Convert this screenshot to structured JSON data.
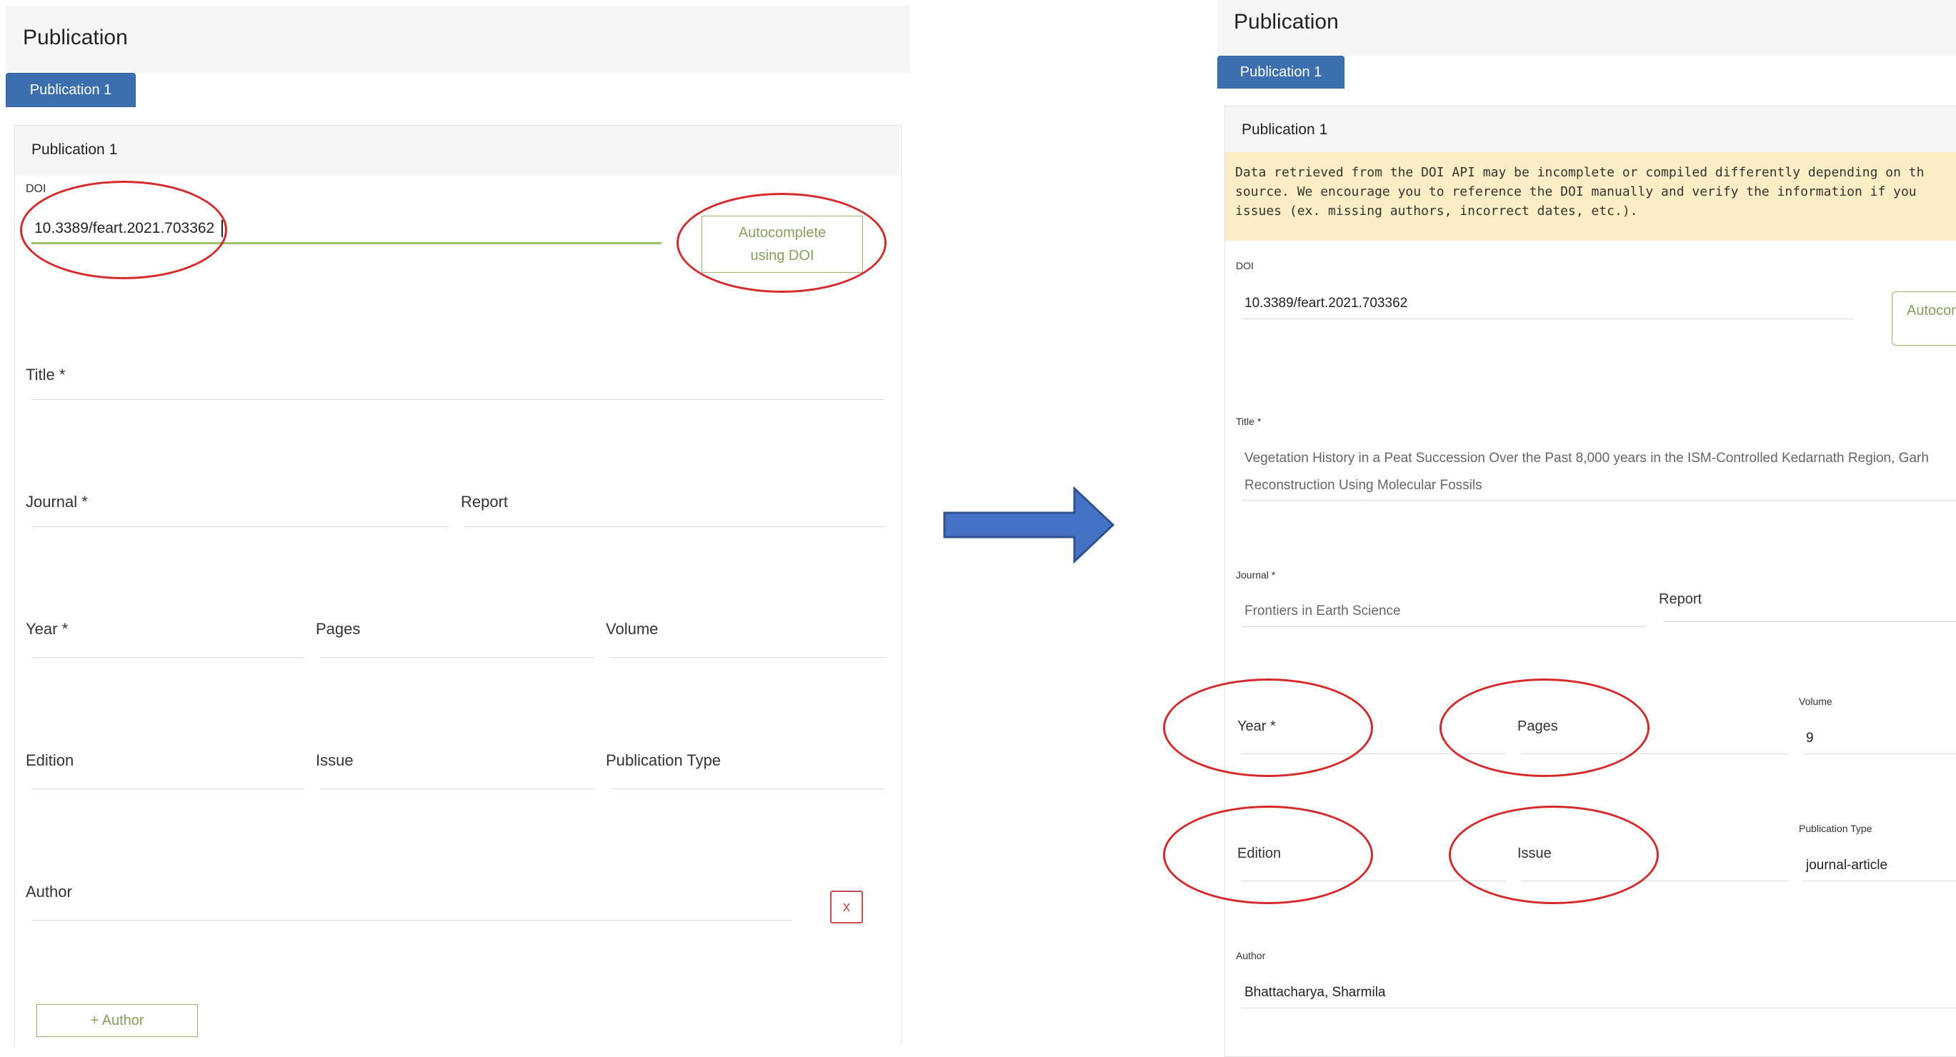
{
  "left": {
    "title": "Publication",
    "tab_label": "Publication 1",
    "card_title": "Publication 1",
    "doi_label": "DOI",
    "doi_value": "10.3389/feart.2021.703362",
    "autocomplete_label": "Autocomplete using DOI",
    "title_label": "Title *",
    "journal_label": "Journal *",
    "report_label": "Report",
    "year_label": "Year *",
    "pages_label": "Pages",
    "volume_label": "Volume",
    "edition_label": "Edition",
    "issue_label": "Issue",
    "publication_type_label": "Publication Type",
    "author_label": "Author",
    "remove_author_label": "x",
    "add_author_label": "+ Author"
  },
  "right": {
    "title": "Publication",
    "tab_label": "Publication 1",
    "card_title": "Publication 1",
    "warning_line1": "Data retrieved from the DOI API may be incomplete or compiled differently depending on th",
    "warning_line2": "source. We encourage you to reference the DOI manually and verify the information if you",
    "warning_line3": "issues (ex. missing authors, incorrect dates, etc.).",
    "doi_label": "DOI",
    "doi_value": "10.3389/feart.2021.703362",
    "autocomplete_label": "Autocom",
    "title_label": "Title *",
    "title_line1": "Vegetation History in a Peat Succession Over the Past 8,000 years in the ISM-Controlled Kedarnath Region, Garh",
    "title_line2": "Reconstruction Using Molecular Fossils",
    "journal_label": "Journal *",
    "journal_value": "Frontiers in Earth Science",
    "report_label": "Report",
    "year_label": "Year *",
    "pages_label": "Pages",
    "volume_label": "Volume",
    "volume_value": "9",
    "edition_label": "Edition",
    "issue_label": "Issue",
    "publication_type_label": "Publication Type",
    "publication_type_value": "journal-article",
    "author_label": "Author",
    "author_value": "Bhattacharya, Sharmila"
  },
  "colors": {
    "tab_blue": "#3b6fb0",
    "accent_green": "#86a05a",
    "highlight_red": "#d62a2a",
    "arrow_blue": "#4472c4",
    "warning_bg": "#fbeec4"
  },
  "icons": {
    "transition_arrow": "right-arrow-icon"
  }
}
